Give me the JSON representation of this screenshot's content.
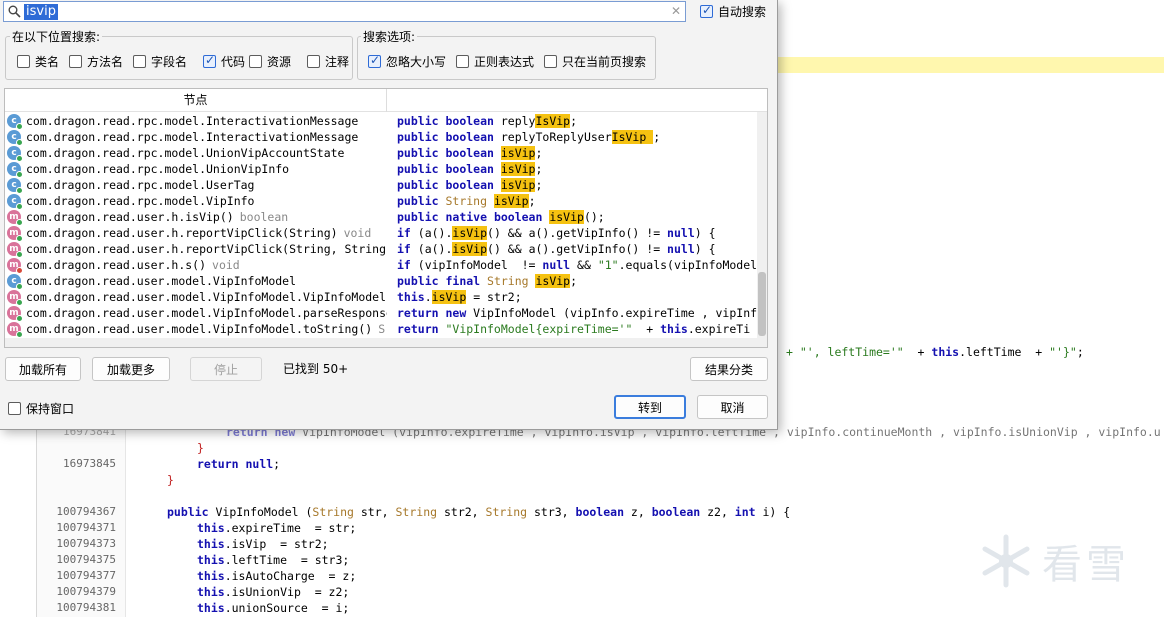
{
  "search": {
    "query": "isvip",
    "auto_search_label": "自动搜索"
  },
  "search_in": {
    "legend": "在以下位置搜索:",
    "options": [
      {
        "label": "类名",
        "checked": false
      },
      {
        "label": "方法名",
        "checked": false
      },
      {
        "label": "字段名",
        "checked": false
      },
      {
        "label": "代码",
        "checked": true
      },
      {
        "label": "资源",
        "checked": false
      },
      {
        "label": "注释",
        "checked": false
      }
    ]
  },
  "search_options": {
    "legend": "搜索选项:",
    "options": [
      {
        "label": "忽略大小写",
        "checked": true
      },
      {
        "label": "正则表达式",
        "checked": false
      },
      {
        "label": "只在当前页搜索",
        "checked": false
      }
    ]
  },
  "results": {
    "node_header": "节点",
    "rows": [
      {
        "icon": "class",
        "dot": "green",
        "node": "com.dragon.read.rpc.model.InteractivationMessage",
        "suffix": "",
        "code": [
          [
            "kw",
            "public "
          ],
          [
            "kw",
            "boolean "
          ],
          [
            "t",
            "reply"
          ],
          [
            "hl",
            "IsVip"
          ],
          [
            "t",
            ";"
          ]
        ]
      },
      {
        "icon": "class",
        "dot": "green",
        "node": "com.dragon.read.rpc.model.InteractivationMessage",
        "suffix": "",
        "code": [
          [
            "kw",
            "public "
          ],
          [
            "kw",
            "boolean "
          ],
          [
            "t",
            "replyToReplyUser"
          ],
          [
            "hl",
            "IsVip "
          ],
          [
            "t",
            ";"
          ]
        ]
      },
      {
        "icon": "class",
        "dot": "green",
        "node": "com.dragon.read.rpc.model.UnionVipAccountState",
        "suffix": "",
        "code": [
          [
            "kw",
            "public "
          ],
          [
            "kw",
            "boolean "
          ],
          [
            "hl",
            "isVip"
          ],
          [
            "t",
            ";"
          ]
        ]
      },
      {
        "icon": "class",
        "dot": "green",
        "node": "com.dragon.read.rpc.model.UnionVipInfo",
        "suffix": "",
        "code": [
          [
            "kw",
            "public "
          ],
          [
            "kw",
            "boolean "
          ],
          [
            "hl",
            "isVip"
          ],
          [
            "t",
            ";"
          ]
        ]
      },
      {
        "icon": "class",
        "dot": "green",
        "node": "com.dragon.read.rpc.model.UserTag",
        "suffix": "",
        "code": [
          [
            "kw",
            "public "
          ],
          [
            "kw",
            "boolean "
          ],
          [
            "hl",
            "isVip"
          ],
          [
            "t",
            ";"
          ]
        ]
      },
      {
        "icon": "class",
        "dot": "green",
        "node": "com.dragon.read.rpc.model.VipInfo",
        "suffix": "",
        "code": [
          [
            "kw",
            "public "
          ],
          [
            "ty",
            "String "
          ],
          [
            "hl",
            "isVip"
          ],
          [
            "t",
            ";"
          ]
        ]
      },
      {
        "icon": "method",
        "dot": "green",
        "node": "com.dragon.read.user.h.isVip()",
        "suffix": "boolean",
        "code": [
          [
            "kw",
            "public "
          ],
          [
            "kw",
            "native "
          ],
          [
            "kw",
            "boolean "
          ],
          [
            "hl",
            "isVip"
          ],
          [
            "t",
            "();"
          ]
        ]
      },
      {
        "icon": "method",
        "dot": "green",
        "node": "com.dragon.read.user.h.reportVipClick(String)",
        "suffix": "void",
        "code": [
          [
            "kw",
            "if "
          ],
          [
            "t",
            "(a()."
          ],
          [
            "hl",
            "isVip"
          ],
          [
            "t",
            "() && a().getVipInfo() != "
          ],
          [
            "kw",
            "null"
          ],
          [
            "t",
            ") {"
          ]
        ]
      },
      {
        "icon": "method",
        "dot": "green",
        "node": "com.dragon.read.user.h.reportVipClick(String, String",
        "suffix": "",
        "code": [
          [
            "kw",
            "if "
          ],
          [
            "t",
            "(a()."
          ],
          [
            "hl",
            "isVip"
          ],
          [
            "t",
            "() && a().getVipInfo() != "
          ],
          [
            "kw",
            "null"
          ],
          [
            "t",
            ") {"
          ]
        ]
      },
      {
        "icon": "method",
        "dot": "red",
        "node": "com.dragon.read.user.h.s()",
        "suffix": "void",
        "code": [
          [
            "kw",
            "if "
          ],
          [
            "t",
            "(vipInfoModel  != "
          ],
          [
            "kw",
            "null "
          ],
          [
            "t",
            "&& "
          ],
          [
            "str",
            "\"1\""
          ],
          [
            "t",
            ".equals(vipInfoModel"
          ]
        ]
      },
      {
        "icon": "class",
        "dot": "green",
        "node": "com.dragon.read.user.model.VipInfoModel",
        "suffix": "",
        "code": [
          [
            "kw",
            "public "
          ],
          [
            "kw",
            "final "
          ],
          [
            "ty",
            "String "
          ],
          [
            "hl",
            "isVip"
          ],
          [
            "t",
            ";"
          ]
        ]
      },
      {
        "icon": "method",
        "dot": "green",
        "node": "com.dragon.read.user.model.VipInfoModel.VipInfoModel",
        "suffix": "",
        "code": [
          [
            "kw",
            "this"
          ],
          [
            "t",
            "."
          ],
          [
            "hl",
            "isVip"
          ],
          [
            "t",
            " = str2;"
          ]
        ]
      },
      {
        "icon": "method",
        "dot": "green",
        "node": "com.dragon.read.user.model.VipInfoModel.parseResponse",
        "suffix": "",
        "code": [
          [
            "kw",
            "return "
          ],
          [
            "kw",
            "new "
          ],
          [
            "t",
            "VipInfoModel (vipInfo.expireTime , vipInf"
          ]
        ]
      },
      {
        "icon": "method",
        "dot": "green",
        "node": "com.dragon.read.user.model.VipInfoModel.toString()",
        "suffix": "S",
        "code": [
          [
            "kw",
            "return "
          ],
          [
            "str",
            "\"VipInfoModel{expireTime='\""
          ],
          [
            "t",
            "  + "
          ],
          [
            "kw",
            "this"
          ],
          [
            "t",
            ".expireTi"
          ]
        ]
      }
    ]
  },
  "buttons": {
    "load_all": "加载所有",
    "load_more": "加载更多",
    "stop": "停止",
    "group_results": "结果分类",
    "goto": "转到",
    "cancel": "取消"
  },
  "status": {
    "found": "已找到 50+"
  },
  "keep_window_label": "保持窗口",
  "editor": {
    "tail_line": [
      [
        "str",
        "+ \"', leftTime='\""
      ],
      [
        "t",
        "  + "
      ],
      [
        "kw",
        "this"
      ],
      [
        "t",
        ".leftTime  + "
      ],
      [
        "str",
        "\"'}\""
      ],
      [
        "t",
        ";"
      ]
    ],
    "lines": [
      {
        "num": "16973841",
        "code": [
          [
            "kw",
            "return "
          ],
          [
            "kw",
            "new "
          ],
          [
            "t",
            "VipInfoModel (vipInfo.expireTime , vipInfo.isVip , vipInfo.leftTime , vipInfo.continueMonth , vipInfo.isUnionVip , vipInfo.u"
          ]
        ]
      },
      {
        "num": "",
        "code": [
          [
            "br",
            "}"
          ]
        ]
      },
      {
        "num": "16973845",
        "code": [
          [
            "kw",
            "return "
          ],
          [
            "kw",
            "null"
          ],
          [
            "t",
            ";"
          ]
        ]
      },
      {
        "num": "",
        "code": [
          [
            "br",
            "}"
          ]
        ]
      },
      {
        "num": "",
        "code": []
      },
      {
        "num": "100794367",
        "code": [
          [
            "kw",
            "public "
          ],
          [
            "t",
            "VipInfoModel ("
          ],
          [
            "ty",
            "String "
          ],
          [
            "t",
            "str, "
          ],
          [
            "ty",
            "String "
          ],
          [
            "t",
            "str2, "
          ],
          [
            "ty",
            "String "
          ],
          [
            "t",
            "str3, "
          ],
          [
            "kw",
            "boolean "
          ],
          [
            "t",
            "z, "
          ],
          [
            "kw",
            "boolean "
          ],
          [
            "t",
            "z2, "
          ],
          [
            "kw",
            "int "
          ],
          [
            "t",
            "i) {"
          ]
        ]
      },
      {
        "num": "100794371",
        "code": [
          [
            "kw",
            "this"
          ],
          [
            "t",
            ".expireTime  = str;"
          ]
        ]
      },
      {
        "num": "100794373",
        "code": [
          [
            "kw",
            "this"
          ],
          [
            "t",
            ".isVip  = str2;"
          ]
        ]
      },
      {
        "num": "100794375",
        "code": [
          [
            "kw",
            "this"
          ],
          [
            "t",
            ".leftTime  = str3;"
          ]
        ]
      },
      {
        "num": "100794377",
        "code": [
          [
            "kw",
            "this"
          ],
          [
            "t",
            ".isAutoCharge  = z;"
          ]
        ]
      },
      {
        "num": "100794379",
        "code": [
          [
            "kw",
            "this"
          ],
          [
            "t",
            ".isUnionVip  = z2;"
          ]
        ]
      },
      {
        "num": "100794381",
        "code": [
          [
            "kw",
            "this"
          ],
          [
            "t",
            ".unionSource  = i;"
          ]
        ]
      }
    ]
  },
  "watermark": "看雪"
}
